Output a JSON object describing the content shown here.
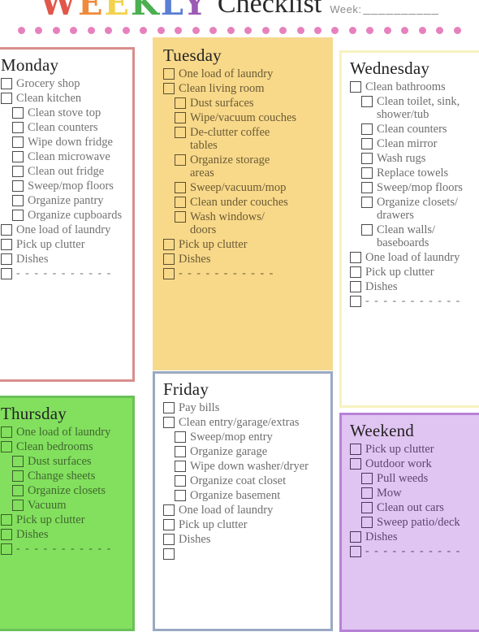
{
  "header": {
    "weekly_word": "WEEKLY",
    "weekly_letters": [
      {
        "char": "W",
        "color": "#e2564a"
      },
      {
        "char": "E",
        "color": "#ef8a3c"
      },
      {
        "char": "E",
        "color": "#f2d24d"
      },
      {
        "char": "K",
        "color": "#4caf50"
      },
      {
        "char": "L",
        "color": "#5b7fd4"
      },
      {
        "char": "Y",
        "color": "#9c5bb5"
      }
    ],
    "checklist_word": "Checklist",
    "week_label": "Week:",
    "week_blank": "__________",
    "dot_color": "#e165b0",
    "dot_count": 26
  },
  "days": [
    {
      "id": "monday",
      "title": "Monday",
      "border_color": "#d98d8d",
      "background": "#ffffff",
      "items": [
        {
          "label": "Grocery shop",
          "sub": false
        },
        {
          "label": "Clean kitchen",
          "sub": false
        },
        {
          "label": "Clean stove top",
          "sub": true
        },
        {
          "label": "Clean counters",
          "sub": true
        },
        {
          "label": "Wipe down fridge",
          "sub": true
        },
        {
          "label": "Clean microwave",
          "sub": true
        },
        {
          "label": "Clean out fridge",
          "sub": true
        },
        {
          "label": "Sweep/mop floors",
          "sub": true
        },
        {
          "label": "Organize pantry",
          "sub": true
        },
        {
          "label": "Organize cupboards",
          "sub": true
        },
        {
          "label": "One load of laundry",
          "sub": false
        },
        {
          "label": "Pick up clutter",
          "sub": false
        },
        {
          "label": "Dishes",
          "sub": false
        },
        {
          "label": "- - - - - - - - - - -",
          "sub": false,
          "blank": true
        }
      ]
    },
    {
      "id": "tuesday",
      "title": "Tuesday",
      "border_color": "#f5d98e",
      "background": "#f8d98a",
      "items": [
        {
          "label": "One load of laundry",
          "sub": false
        },
        {
          "label": "Clean living room",
          "sub": false
        },
        {
          "label": "Dust surfaces",
          "sub": true
        },
        {
          "label": "Wipe/vacuum couches",
          "sub": true
        },
        {
          "label": "De-clutter coffee\ntables",
          "sub": true
        },
        {
          "label": "Organize storage\nareas",
          "sub": true
        },
        {
          "label": "Sweep/vacuum/mop",
          "sub": true
        },
        {
          "label": "Clean under couches",
          "sub": true
        },
        {
          "label": "Wash windows/\ndoors",
          "sub": true
        },
        {
          "label": "Pick up clutter",
          "sub": false
        },
        {
          "label": "Dishes",
          "sub": false
        },
        {
          "label": "- - - - - - - - - - -",
          "sub": false,
          "blank": true
        }
      ]
    },
    {
      "id": "wednesday",
      "title": "Wednesday",
      "border_color": "#f7f2c0",
      "background": "#ffffff",
      "items": [
        {
          "label": "Clean bathrooms",
          "sub": false
        },
        {
          "label": "Clean toilet, sink,\nshower/tub",
          "sub": true
        },
        {
          "label": "Clean counters",
          "sub": true
        },
        {
          "label": "Clean mirror",
          "sub": true
        },
        {
          "label": "Wash rugs",
          "sub": true
        },
        {
          "label": "Replace towels",
          "sub": true
        },
        {
          "label": "Sweep/mop floors",
          "sub": true
        },
        {
          "label": "Organize closets/\ndrawers",
          "sub": true
        },
        {
          "label": "Clean walls/\nbaseboards",
          "sub": true
        },
        {
          "label": "One load of laundry",
          "sub": false
        },
        {
          "label": "Pick up clutter",
          "sub": false
        },
        {
          "label": "Dishes",
          "sub": false
        },
        {
          "label": "- - - - - - - - - - -",
          "sub": false,
          "blank": true
        }
      ]
    },
    {
      "id": "thursday",
      "title": "Thursday",
      "border_color": "#6cc05a",
      "background": "#82e05e",
      "items": [
        {
          "label": "One load of laundry",
          "sub": false
        },
        {
          "label": "Clean bedrooms",
          "sub": false
        },
        {
          "label": "Dust surfaces",
          "sub": true
        },
        {
          "label": "Change sheets",
          "sub": true
        },
        {
          "label": "Organize closets",
          "sub": true
        },
        {
          "label": "Vacuum",
          "sub": true
        },
        {
          "label": "Pick up clutter",
          "sub": false
        },
        {
          "label": "Dishes",
          "sub": false
        },
        {
          "label": "- - - - - - - - - - -",
          "sub": false,
          "blank": true
        }
      ]
    },
    {
      "id": "friday",
      "title": "Friday",
      "border_color": "#9aa9c2",
      "background": "#ffffff",
      "items": [
        {
          "label": "Pay bills",
          "sub": false
        },
        {
          "label": "Clean entry/garage/extras",
          "sub": false
        },
        {
          "label": "Sweep/mop entry",
          "sub": true
        },
        {
          "label": "Organize garage",
          "sub": true
        },
        {
          "label": "Wipe down washer/dryer",
          "sub": true
        },
        {
          "label": "Organize coat closet",
          "sub": true
        },
        {
          "label": "Organize basement",
          "sub": true
        },
        {
          "label": "One load of laundry",
          "sub": false
        },
        {
          "label": "Pick up clutter",
          "sub": false
        },
        {
          "label": "Dishes",
          "sub": false
        },
        {
          "label": "",
          "sub": false,
          "blank": true
        }
      ]
    },
    {
      "id": "weekend",
      "title": "Weekend",
      "border_color": "#b782d6",
      "background": "#e0c4f2",
      "items": [
        {
          "label": "Pick up clutter",
          "sub": false
        },
        {
          "label": "Outdoor work",
          "sub": false
        },
        {
          "label": "Pull weeds",
          "sub": true
        },
        {
          "label": "Mow",
          "sub": true
        },
        {
          "label": "Clean out cars",
          "sub": true
        },
        {
          "label": "Sweep patio/deck",
          "sub": true
        },
        {
          "label": "Dishes",
          "sub": false
        },
        {
          "label": "- - - - - - - - - - -",
          "sub": false,
          "blank": true
        }
      ]
    }
  ]
}
